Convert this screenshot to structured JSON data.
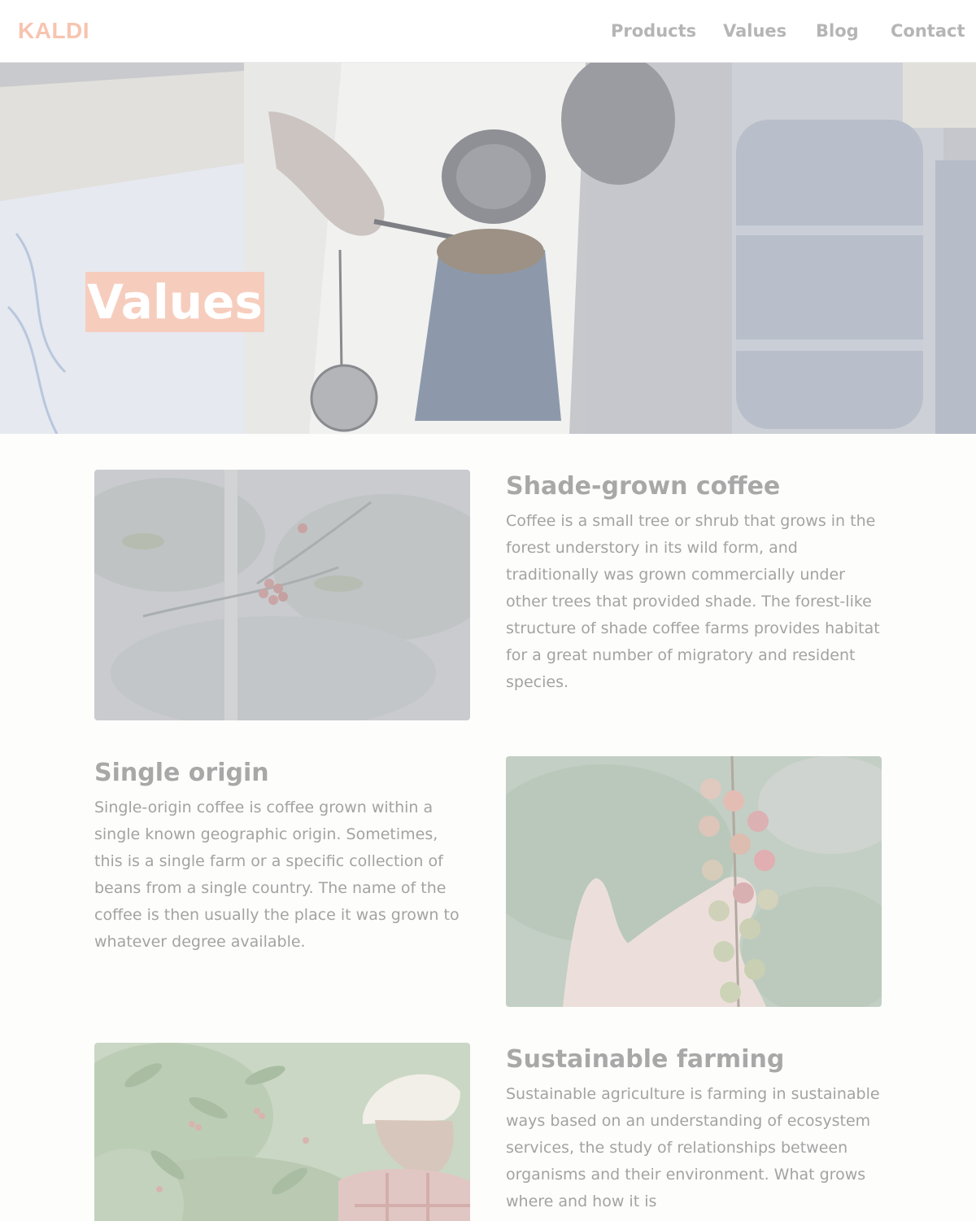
{
  "brand": {
    "logo": "KALDI",
    "accent": "#f6cdbd"
  },
  "nav": {
    "items": [
      {
        "label": "Products"
      },
      {
        "label": "Values"
      },
      {
        "label": "Blog"
      },
      {
        "label": "Contact"
      }
    ]
  },
  "hero": {
    "title": "Values"
  },
  "features": [
    {
      "title": "Shade-grown coffee",
      "body": "Coffee is a small tree or shrub that grows in the forest understory in its wild form, and traditionally was grown commercially under other trees that provided shade. The forest-like structure of shade coffee farms provides habitat for a great number of migratory and resident species."
    },
    {
      "title": "Single origin",
      "body": "Single-origin coffee is coffee grown within a single known geographic origin. Sometimes, this is a single farm or a specific collection of beans from a single country. The name of the coffee is then usually the place it was grown to whatever degree available."
    },
    {
      "title": "Sustainable farming",
      "body": "Sustainable agriculture is farming in sustainable ways based on an understanding of ecosystem services, the study of relationships between organisms and their environment. What grows where and how it is"
    }
  ]
}
